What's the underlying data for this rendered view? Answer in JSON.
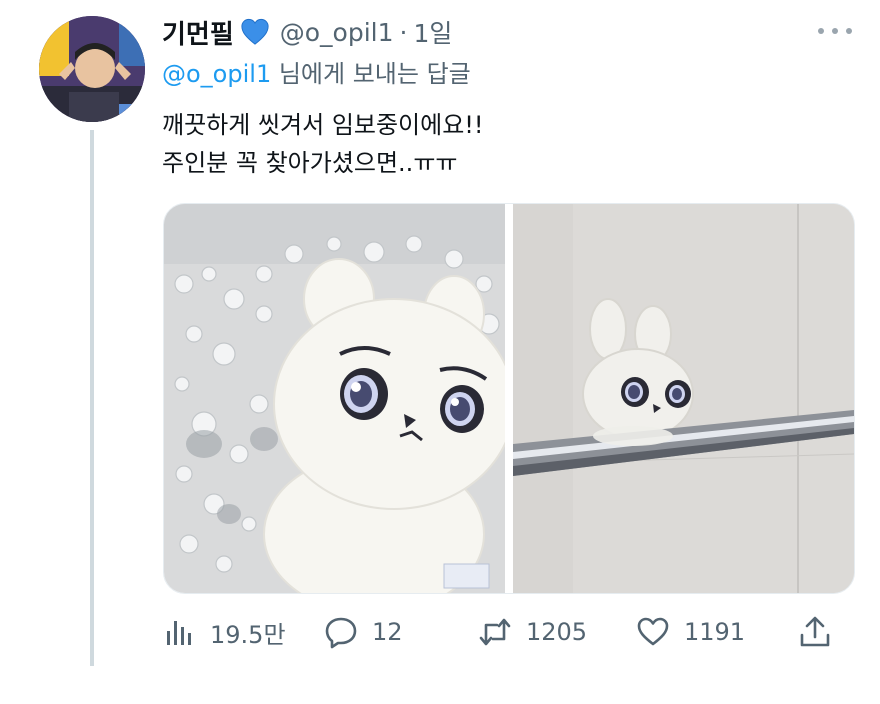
{
  "author": {
    "display_name": "기먼필",
    "badge_icon": "blue-heart-emoji",
    "handle": "@o_opil1",
    "separator": "·",
    "time": "1일"
  },
  "reply_context": {
    "mention": "@o_opil1",
    "suffix": " 님에게 보내는 답글"
  },
  "tweet": {
    "lines": [
      "깨끗하게 씻겨서 임보중이에요!!",
      "주인분 꼭 찾아가셨으면..ㅠㅠ"
    ]
  },
  "media": {
    "images": [
      "plush-in-bubble-bath-photo",
      "plush-on-towel-rail-photo"
    ]
  },
  "actions": {
    "views": {
      "icon": "bar-chart-icon",
      "count": "19.5만"
    },
    "replies": {
      "icon": "reply-bubble-icon",
      "count": "12"
    },
    "retweets": {
      "icon": "retweet-icon",
      "count": "1205"
    },
    "likes": {
      "icon": "heart-icon",
      "count": "1191"
    },
    "share": {
      "icon": "share-upload-icon"
    }
  },
  "colors": {
    "link": "#1d9bf0",
    "secondary_text": "#536471",
    "thread_line": "#cfd9de"
  }
}
